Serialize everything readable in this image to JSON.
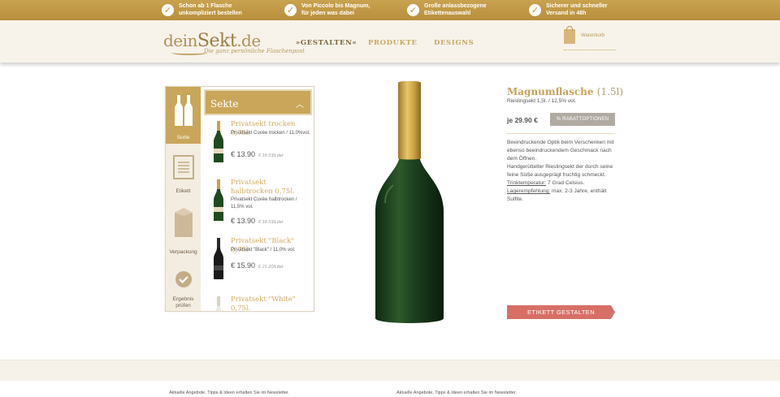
{
  "benefits": [
    {
      "line1": "Schon ab 1 Flasche",
      "line2": "unkompliziert bestellen"
    },
    {
      "line1": "Von Piccolo bis Magnum,",
      "line2": "für jeden was dabei"
    },
    {
      "line1": "Große anlassbezogene",
      "line2": "Etikettenauswahl"
    },
    {
      "line1": "Sicherer und schneller",
      "line2": "Versand in 48h"
    }
  ],
  "header": {
    "logo_part1": "dein",
    "logo_part2": "Sekt",
    "logo_part3": ".de",
    "logo_tagline": "Die ganz persönliche Flaschenpost",
    "nav": [
      {
        "label": "»GESTALTEN«",
        "active": true
      },
      {
        "label": "PRODUKTE",
        "active": false
      },
      {
        "label": "DESIGNS",
        "active": false
      }
    ],
    "cart_label": "Warenkorb"
  },
  "configurator": {
    "steps": [
      {
        "label": "Sorte",
        "icon": "bottles-icon",
        "active": true
      },
      {
        "label": "Etikett",
        "icon": "label-icon",
        "active": false
      },
      {
        "label": "Verpackung",
        "icon": "box-icon",
        "active": false
      },
      {
        "label": "Ergebnis prüfen",
        "icon": "check-circle-icon",
        "active": false
      }
    ],
    "list_title": "Sekte",
    "products": [
      {
        "name": "Privatsekt trocken 0,75l.",
        "desc": "Privatsekt Cuvée trocken / 11,0%vol.",
        "price": "€ 13.90",
        "per_liter": "€ 18.53/Liter"
      },
      {
        "name": "Privatsekt halbtrocken 0,75l.",
        "desc": "Privatsekt Cuvée halbtrocken / 11,5% vol.",
        "price": "€ 13.90",
        "per_liter": "€ 18.53/Liter"
      },
      {
        "name": "Privatsekt \"Black\" 0,75l",
        "desc": "Privatsekt \"Black\" / 11,0% vol.",
        "price": "€ 15.90",
        "per_liter": "€ 21.20/Liter"
      },
      {
        "name": "Privatsekt \"White\" 0,75l.",
        "desc": "",
        "price": "",
        "per_liter": ""
      }
    ]
  },
  "product": {
    "title": "Magnumflasche",
    "size": "(1.5l)",
    "subtitle": "Rieslingsekt 1,5l. / 12,5% vol.",
    "price": "je 29.90 €",
    "rebate_label": "% RABATTOPTIONEN",
    "desc_intro": "Beeindruckende Optik beim Verschenken mit ebenso beeindruckendem Geschmack nach dem Öffnen.",
    "desc_main": "Handgerüttelter Rieslingsekt der durch seine feine Süße ausgeprägt fruchtig schmeckt.",
    "temp_label": "Trinktemperatur:",
    "temp_value": " 7 Grad Celsius.",
    "storage_label": "Lagerempfehlung:",
    "storage_value": " max. 2-3 Jahre, enthält Sulfite.",
    "cta_label": "ETIKETT GESTALTEN"
  },
  "footer": {
    "newsletter_left": "Aktuelle Angebote, Tipps & Ideen erhalten Sie im Newsletter.",
    "newsletter_right": "Aktuelle Angebote, Tipps & Ideen erhalten Sie im Newsletter."
  },
  "colors": {
    "gold": "#c9a65a",
    "cta": "#d76f66",
    "grey_button": "#b0aaa2"
  }
}
